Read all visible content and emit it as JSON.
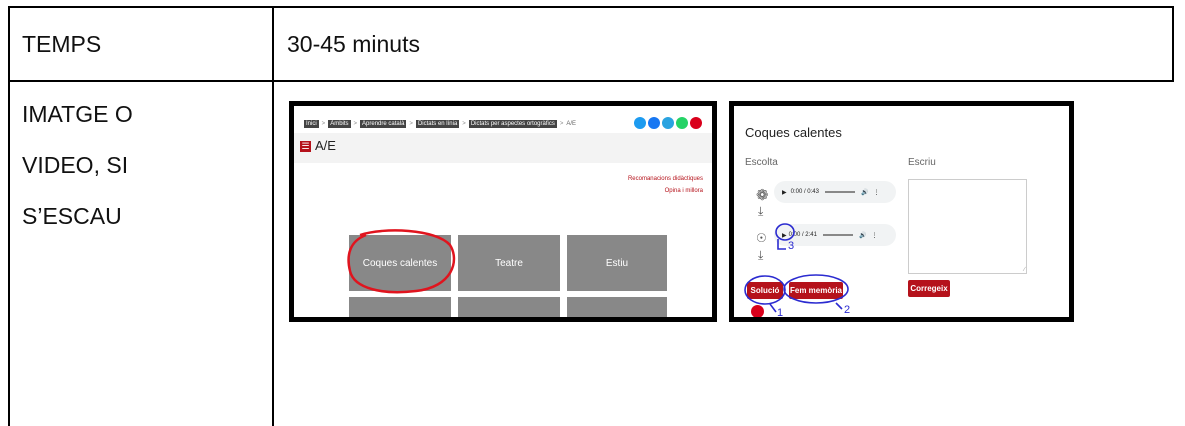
{
  "table": {
    "row1": {
      "label": "TEMPS",
      "value": "30-45 minuts"
    },
    "row2": {
      "label_lines": [
        "IMATGE O",
        "VIDEO, SI",
        "S’ESCAU"
      ]
    }
  },
  "screenshot_left": {
    "breadcrumb": [
      "Inici",
      "Àmbits",
      "Aprendre català",
      "Dictats en línia",
      "Dictats per aspectes ortogràfics"
    ],
    "breadcrumb_current": "A/E",
    "breadcrumb_sep": ">",
    "page_title": "A/E",
    "links": [
      "Recomanacions didàctiques",
      "Opina i millora"
    ],
    "tiles": [
      "Coques calentes",
      "Teatre",
      "Estiu"
    ],
    "social_colors": [
      "#1d9bf0",
      "#1877f2",
      "#2aa3e0",
      "#25d366",
      "#d9001b"
    ]
  },
  "screenshot_right": {
    "title": "Coques calentes",
    "listen_label": "Escolta",
    "write_label": "Escriu",
    "player1_time": "0:00 / 0:43",
    "player2_time": "0:00 / 2:41",
    "solution_button": "Solució",
    "memory_button": "Fem memòria",
    "correct_button": "Corregeix",
    "annotations": [
      "3",
      "1",
      "2"
    ]
  },
  "colors": {
    "accent_red": "#b5121b",
    "annotation_blue": "#2b2bd0",
    "annotation_red": "#e0141e"
  }
}
